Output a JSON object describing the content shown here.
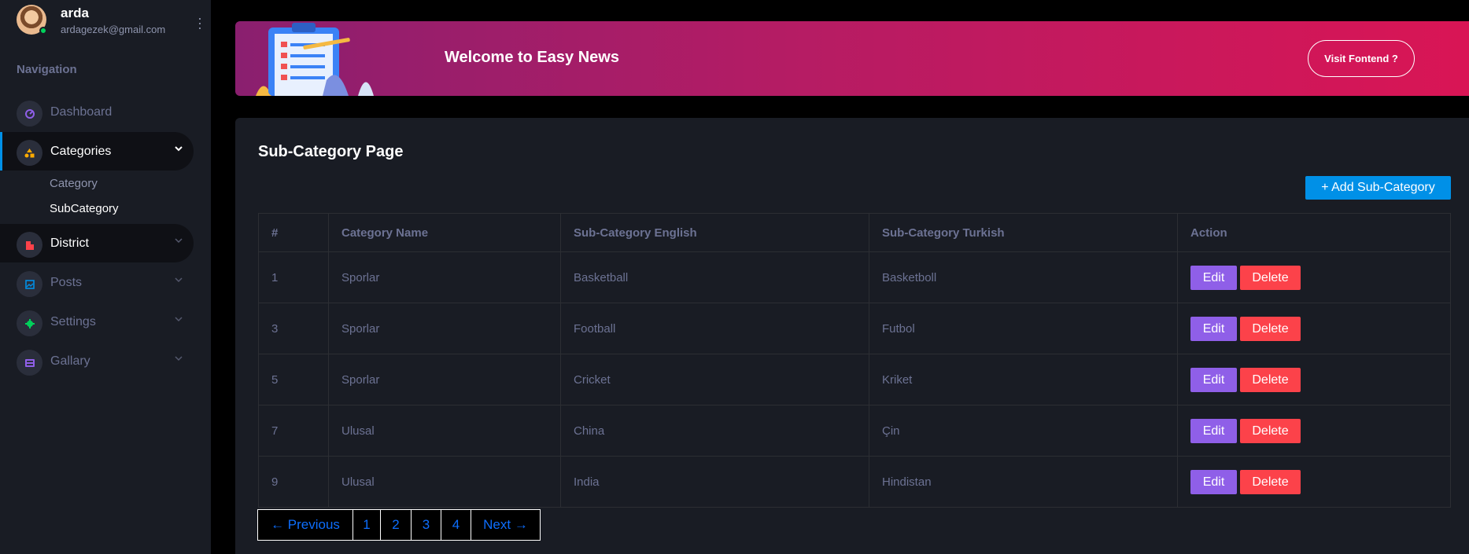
{
  "profile": {
    "name": "arda",
    "email": "ardagezek@gmail.com"
  },
  "sidebar": {
    "heading": "Navigation",
    "items": [
      {
        "label": "Dashboard",
        "icon": "speedometer-icon",
        "color": "#8f5fe8"
      },
      {
        "label": "Categories",
        "icon": "shapes-icon",
        "color": "#ffab00"
      },
      {
        "label": "District",
        "icon": "building-icon",
        "color": "#fc424a"
      },
      {
        "label": "Posts",
        "icon": "image-icon",
        "color": "#0090e7"
      },
      {
        "label": "Settings",
        "icon": "gear-icon",
        "color": "#00d25b"
      },
      {
        "label": "Gallary",
        "icon": "gallery-icon",
        "color": "#8f5fe8"
      }
    ],
    "sub_items": [
      "Category",
      "SubCategory"
    ]
  },
  "banner": {
    "title": "Welcome to Easy News",
    "button": "Visit Fontend ?"
  },
  "page": {
    "title": "Sub-Category Page",
    "add_button": "+ Add Sub-Category",
    "columns": [
      "#",
      "Category Name",
      "Sub-Category English",
      "Sub-Category Turkish",
      "Action"
    ],
    "rows": [
      {
        "id": "1",
        "category": "Sporlar",
        "english": "Basketball",
        "turkish": "Basketboll"
      },
      {
        "id": "3",
        "category": "Sporlar",
        "english": "Football",
        "turkish": "Futbol"
      },
      {
        "id": "5",
        "category": "Sporlar",
        "english": "Cricket",
        "turkish": "Kriket"
      },
      {
        "id": "7",
        "category": "Ulusal",
        "english": "China",
        "turkish": "Çin"
      },
      {
        "id": "9",
        "category": "Ulusal",
        "english": "India",
        "turkish": "Hindistan"
      }
    ],
    "edit_label": "Edit",
    "delete_label": "Delete"
  },
  "pagination": {
    "previous": "← Previous",
    "pages": [
      "1",
      "2",
      "3",
      "4"
    ],
    "next": "Next →"
  }
}
